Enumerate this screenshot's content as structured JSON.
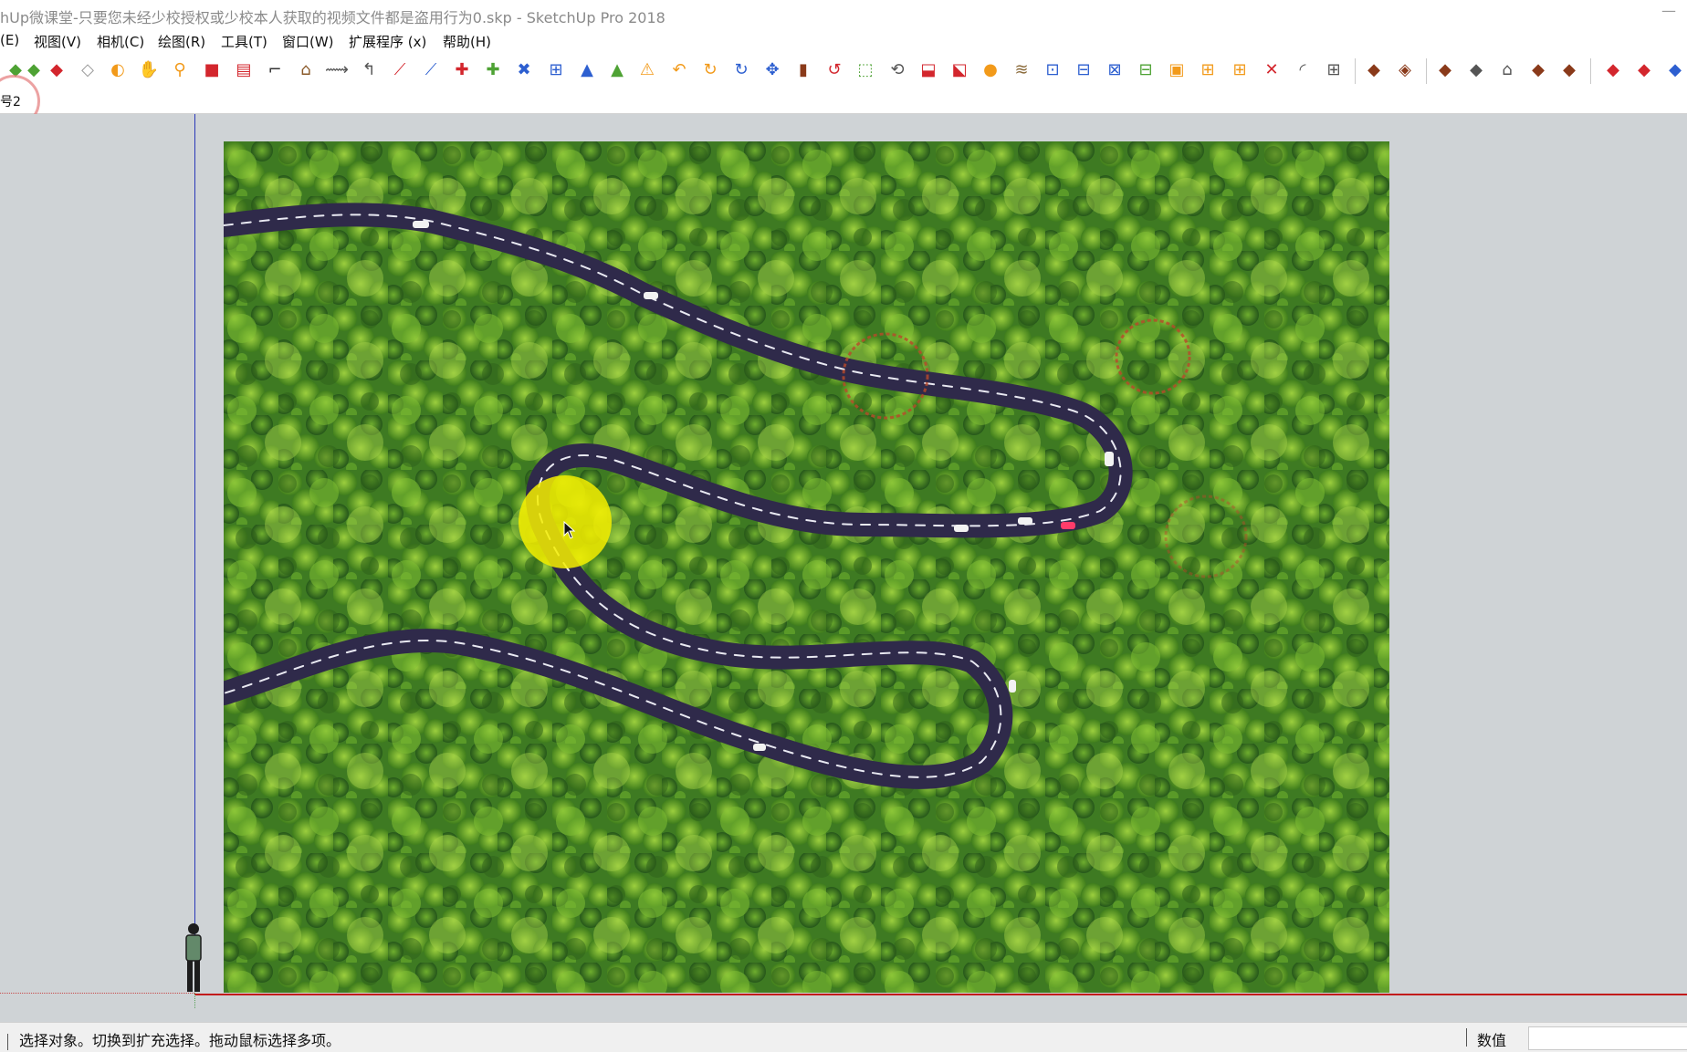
{
  "window": {
    "title": "hUp微课堂-只要您未经少校授权或少校本人获取的视频文件都是盗用行为0.skp - SketchUp Pro 2018",
    "minimize_glyph": "—"
  },
  "menu": {
    "items": [
      "(E)",
      "视图(V)",
      "相机(C)",
      "绘图(R)",
      "工具(T)",
      "窗口(W)",
      "扩展程序 (x)",
      "帮助(H)"
    ]
  },
  "toolbar": {
    "icons": [
      "eraser-icon",
      "paint-bucket-icon",
      "tape-icon",
      "orbit-icon",
      "pan-icon",
      "zoom-icon",
      "rectangle-icon",
      "section-icon",
      "arc-icon",
      "follow-me-icon",
      "offset-icon",
      "pushpull-icon",
      "freehand-icon",
      "line-icon",
      "move-icon",
      "rotate-icon",
      "scale-icon",
      "grid-icon",
      "protractor-icon",
      "dimension-icon",
      "text-icon",
      "axes-icon",
      "3d-text-icon",
      "walk-icon",
      "look-around-icon",
      "position-camera-icon",
      "component-icon",
      "undo-icon",
      "redo-icon",
      "style-icon",
      "shadow-icon",
      "fog-icon",
      "layer-icon",
      "outliner-icon",
      "scene-icon",
      "materials-icon",
      "entity-info-icon",
      "soften-icon",
      "instructor-icon",
      "photo-match-icon",
      "geo-location-icon",
      "sandbox-icon",
      "stamp-icon",
      "drape-icon",
      "add-detail-icon",
      "flip-edge-icon",
      "warehouse-icon",
      "extension-icon",
      "layout-icon",
      "send-icon",
      "share-icon",
      "export-icon",
      "solid-icon",
      "intersect-icon",
      "trim-icon",
      "split-icon",
      "union-icon",
      "subtract-icon",
      "outer-shell-icon"
    ],
    "accent_orange": "#f29a1a",
    "accent_red": "#d3262d",
    "accent_blue": "#2d5fd0",
    "accent_green": "#4ea234"
  },
  "scenes": {
    "tab_label": "号2"
  },
  "viewport": {
    "background": "#cfd3d6",
    "image_content": "aerial-winding-road-forest"
  },
  "status": {
    "message": "选择对象。切换到扩充选择。拖动鼠标选择多项。",
    "measurements_label": "数值",
    "measurements_value": ""
  }
}
